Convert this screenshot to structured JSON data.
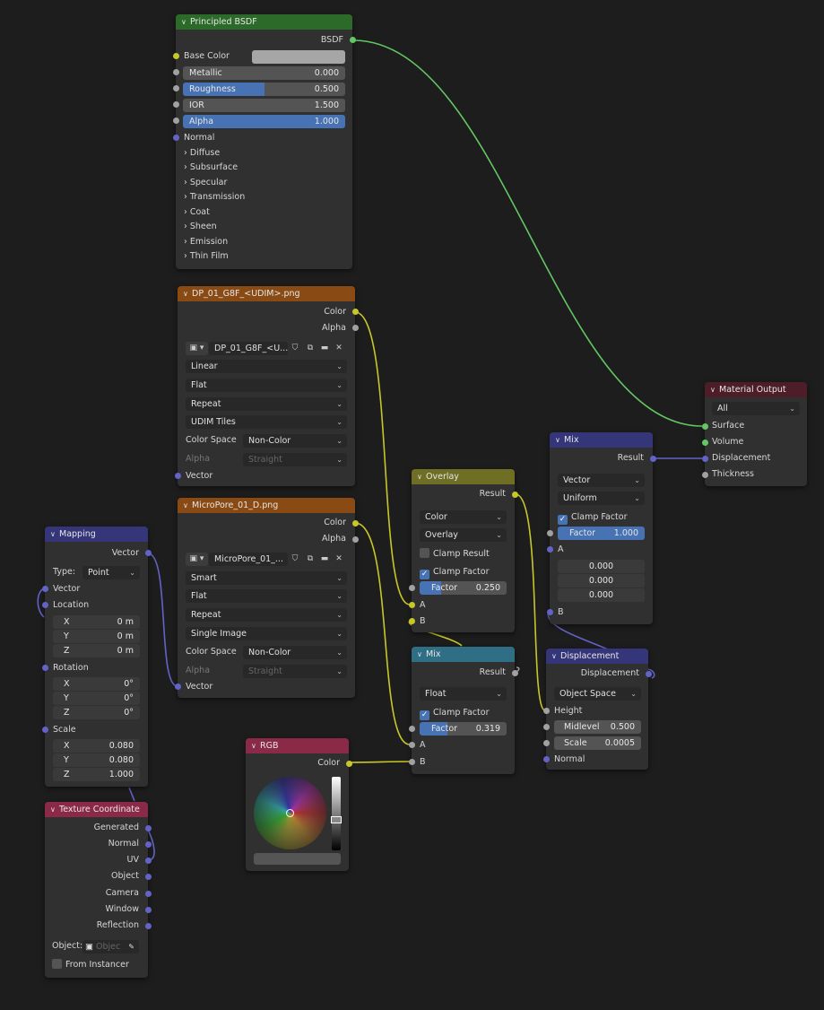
{
  "nodes": {
    "principled": {
      "title": "Principled BSDF",
      "output": "BSDF",
      "base_color": "Base Color",
      "metallic": {
        "label": "Metallic",
        "value": "0.000"
      },
      "roughness": {
        "label": "Roughness",
        "value": "0.500"
      },
      "ior": {
        "label": "IOR",
        "value": "1.500"
      },
      "alpha": {
        "label": "Alpha",
        "value": "1.000"
      },
      "normal": "Normal",
      "panels": [
        "Diffuse",
        "Subsurface",
        "Specular",
        "Transmission",
        "Coat",
        "Sheen",
        "Emission",
        "Thin Film"
      ]
    },
    "image1": {
      "title": "DP_01_G8F_<UDIM>.png",
      "out_color": "Color",
      "out_alpha": "Alpha",
      "image_name": "DP_01_G8F_<U...",
      "interpolation": "Linear",
      "projection": "Flat",
      "extension": "Repeat",
      "source": "UDIM Tiles",
      "color_space_label": "Color Space",
      "color_space": "Non-Color",
      "alpha_label": "Alpha",
      "alpha_value": "Straight",
      "in_vector": "Vector"
    },
    "image2": {
      "title": "MicroPore_01_D.png",
      "out_color": "Color",
      "out_alpha": "Alpha",
      "image_name": "MicroPore_01_...",
      "interpolation": "Smart",
      "projection": "Flat",
      "extension": "Repeat",
      "source": "Single Image",
      "color_space_label": "Color Space",
      "color_space": "Non-Color",
      "alpha_label": "Alpha",
      "alpha_value": "Straight",
      "in_vector": "Vector"
    },
    "mapping": {
      "title": "Mapping",
      "out_vector": "Vector",
      "type_label": "Type:",
      "type_value": "Point",
      "in_vector": "Vector",
      "location": "Location",
      "loc": [
        {
          "axis": "X",
          "value": "0 m"
        },
        {
          "axis": "Y",
          "value": "0 m"
        },
        {
          "axis": "Z",
          "value": "0 m"
        }
      ],
      "rotation": "Rotation",
      "rot": [
        {
          "axis": "X",
          "value": "0°"
        },
        {
          "axis": "Y",
          "value": "0°"
        },
        {
          "axis": "Z",
          "value": "0°"
        }
      ],
      "scale": "Scale",
      "scl": [
        {
          "axis": "X",
          "value": "0.080"
        },
        {
          "axis": "Y",
          "value": "0.080"
        },
        {
          "axis": "Z",
          "value": "1.000"
        }
      ]
    },
    "texcoord": {
      "title": "Texture Coordinate",
      "outputs": [
        "Generated",
        "Normal",
        "UV",
        "Object",
        "Camera",
        "Window",
        "Reflection"
      ],
      "object_label": "Object:",
      "object_placeholder": "Objec",
      "from_instancer": "From Instancer"
    },
    "overlay": {
      "title": "Overlay",
      "out_result": "Result",
      "data_type": "Color",
      "blend_mode": "Overlay",
      "clamp_result": "Clamp Result",
      "clamp_factor": "Clamp Factor",
      "factor": {
        "label": "Factor",
        "value": "0.250",
        "fraction": 0.25
      },
      "in_a": "A",
      "in_b": "B"
    },
    "mix_float": {
      "title": "Mix",
      "out_result": "Result",
      "data_type": "Float",
      "clamp_factor": "Clamp Factor",
      "factor": {
        "label": "Factor",
        "value": "0.319",
        "fraction": 0.319
      },
      "in_a": "A",
      "in_b": "B"
    },
    "rgb": {
      "title": "RGB",
      "out_color": "Color"
    },
    "mix_vector": {
      "title": "Mix",
      "out_result": "Result",
      "data_type": "Vector",
      "factor_mode": "Uniform",
      "clamp_factor": "Clamp Factor",
      "factor": {
        "label": "Factor",
        "value": "1.000",
        "fraction": 1.0
      },
      "in_a": "A",
      "a_values": [
        "0.000",
        "0.000",
        "0.000"
      ],
      "in_b": "B"
    },
    "displacement": {
      "title": "Displacement",
      "out_displacement": "Displacement",
      "space": "Object Space",
      "height": "Height",
      "midlevel": {
        "label": "Midlevel",
        "value": "0.500"
      },
      "scale": {
        "label": "Scale",
        "value": "0.0005"
      },
      "normal": "Normal"
    },
    "output": {
      "title": "Material Output",
      "target": "All",
      "inputs": [
        "Surface",
        "Volume",
        "Displacement",
        "Thickness"
      ]
    }
  },
  "colors": {
    "background": "#1d1d1d",
    "shader_link": "#63c763",
    "color_link": "#c7c729",
    "vector_link": "#6363c7",
    "float_link": "#a1a1a1"
  }
}
